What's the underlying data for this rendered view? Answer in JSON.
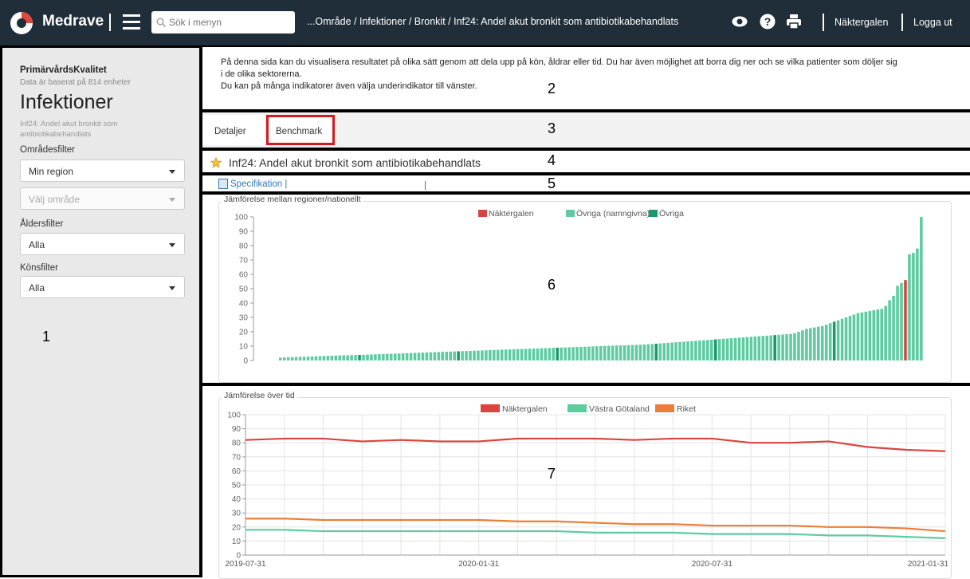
{
  "app": {
    "brand": "Medrave",
    "menu_search_placeholder": "Sök i menyn",
    "breadcrumb": "...Område / Infektioner / Bronkit / Inf24: Andel akut bronkit som antibiotikabehandlats",
    "user": "Näktergalen",
    "logout": "Logga ut"
  },
  "sidebar": {
    "org": "PrimärvårdsKvalitet",
    "basis": "Data är baserat på 814 enheter",
    "title": "Infektioner",
    "indicator": "Inf24: Andel akut bronkit som antibiotikabehandlats",
    "area_filter_label": "Områdesfilter",
    "region_value": "Min region",
    "area_placeholder": "Välj område",
    "age_filter_label": "Åldersfilter",
    "age_value": "Alla",
    "gender_filter_label": "Könsfilter",
    "gender_value": "Alla"
  },
  "info": {
    "line1": "På denna sida kan du visualisera resultatet på olika sätt genom att dela upp på kön, åldrar eller tid. Du har även möjlighet att borra dig ner och se vilka patienter som döljer sig",
    "line2": "i de olika sektorerna.",
    "line3": "Du kan på många indikatorer även välja underindikator till vänster."
  },
  "tabs": [
    "Detaljer",
    "Benchmark"
  ],
  "heading": "Inf24: Andel akut bronkit som antibiotikabehandlats",
  "spec_label": "Specifikation |",
  "annotations": [
    "1",
    "2",
    "3",
    "4",
    "5",
    "6",
    "7"
  ],
  "colors": {
    "nav": "#202e39",
    "own": "#d9443f",
    "named": "#5ecba1",
    "other": "#1a9a6b",
    "region": "#5ecba1",
    "national": "#ea7f3b",
    "highlight": "#d71920"
  },
  "chart_data": [
    {
      "type": "bar",
      "title": "Jämförelse mellan regioner/nationellt",
      "ylim": [
        0,
        100
      ],
      "yticks": [
        0,
        10,
        20,
        30,
        40,
        50,
        60,
        70,
        80,
        90,
        100
      ],
      "legend": [
        "Näktergalen",
        "Övriga (namngivna)",
        "Övriga"
      ],
      "series_by_bar": "sorted ascending, 162 units",
      "values": [
        2.0,
        2.1,
        2.2,
        2.3,
        2.4,
        2.5,
        2.6,
        2.7,
        2.8,
        2.9,
        3.0,
        3.1,
        3.2,
        3.3,
        3.4,
        3.5,
        3.6,
        3.6,
        3.7,
        3.8,
        3.9,
        4.0,
        4.1,
        4.2,
        4.3,
        4.4,
        4.5,
        4.6,
        4.7,
        4.8,
        4.9,
        5.0,
        5.1,
        5.2,
        5.3,
        5.4,
        5.5,
        5.6,
        5.7,
        5.8,
        5.9,
        6.0,
        6.1,
        6.2,
        6.3,
        6.4,
        6.5,
        6.6,
        6.7,
        6.8,
        6.9,
        7.0,
        7.1,
        7.2,
        7.3,
        7.4,
        7.5,
        7.6,
        7.7,
        7.8,
        7.9,
        8.0,
        8.1,
        8.2,
        8.3,
        8.4,
        8.5,
        8.6,
        8.7,
        8.8,
        8.9,
        9.0,
        9.1,
        9.2,
        9.3,
        9.4,
        9.5,
        9.6,
        9.7,
        9.8,
        9.9,
        10.0,
        10.1,
        10.2,
        10.3,
        10.4,
        10.5,
        10.6,
        10.7,
        10.8,
        10.9,
        11.0,
        11.1,
        11.3,
        11.5,
        11.7,
        11.9,
        12.1,
        12.3,
        12.5,
        12.7,
        12.9,
        13.1,
        13.3,
        13.5,
        13.7,
        13.9,
        14.1,
        14.3,
        14.5,
        14.7,
        14.9,
        15.1,
        15.3,
        15.5,
        15.7,
        15.9,
        16.1,
        16.3,
        16.5,
        16.7,
        16.9,
        17.1,
        17.3,
        17.5,
        17.7,
        17.9,
        18.1,
        18.3,
        18.5,
        19.0,
        20.0,
        21.0,
        22.0,
        22.5,
        23.0,
        23.5,
        24.0,
        25.0,
        26.0,
        27.0,
        28.0,
        29.0,
        30.0,
        31.0,
        32.0,
        33.0,
        33.5,
        34.0,
        34.5,
        35.0,
        35.5,
        36.0,
        38.0,
        42.0,
        45.0,
        52.0,
        54.0,
        56.0,
        74.0,
        75.0,
        78.0,
        100.0
      ],
      "highlight_index": 158,
      "dark_indices": [
        20,
        45,
        70,
        95,
        110,
        125,
        140
      ]
    },
    {
      "type": "line",
      "title": "Jämförelse över tid",
      "ylim": [
        0,
        100
      ],
      "yticks": [
        0,
        10,
        20,
        30,
        40,
        50,
        60,
        70,
        80,
        90,
        100
      ],
      "xtick_labels": [
        "2019-07-31",
        "2020-01-31",
        "2020-07-31",
        "2021-01-31"
      ],
      "series": [
        {
          "name": "Näktergalen",
          "values": [
            82,
            83,
            83,
            81,
            82,
            81,
            81,
            83,
            83,
            83,
            82,
            83,
            83,
            80,
            80,
            81,
            77,
            75,
            74
          ]
        },
        {
          "name": "Västra Götaland",
          "values": [
            18,
            18,
            17,
            17,
            17,
            17,
            17,
            17,
            17,
            16,
            16,
            16,
            15,
            15,
            15,
            14,
            14,
            13,
            12
          ]
        },
        {
          "name": "Riket",
          "values": [
            26,
            26,
            25,
            25,
            25,
            25,
            25,
            24,
            24,
            23,
            22,
            22,
            21,
            21,
            21,
            20,
            20,
            19,
            17
          ]
        }
      ]
    }
  ]
}
